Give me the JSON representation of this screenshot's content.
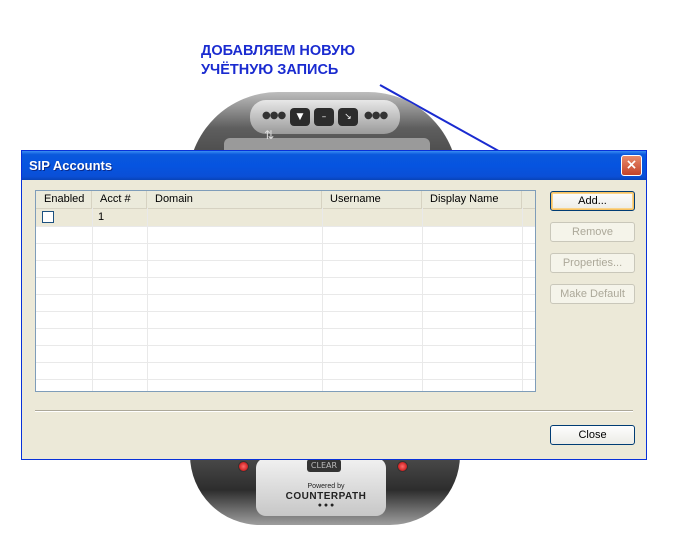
{
  "annotation": {
    "line1": "ДОБАВЛЯЕМ НОВУЮ",
    "line2": "УЧЁТНУЮ ЗАПИСЬ",
    "color": "#1a2bd0"
  },
  "phone": {
    "clear_label": "CLEAR",
    "powered_by": "Powered by",
    "brand": "COUNTERPATH"
  },
  "dialog": {
    "title": "SIP Accounts",
    "close_icon": "×",
    "columns": [
      "Enabled",
      "Acct #",
      "Domain",
      "Username",
      "Display Name"
    ],
    "rows": [
      {
        "enabled": false,
        "acct": "1",
        "domain": "",
        "username": "",
        "display_name": ""
      }
    ],
    "buttons": {
      "add": "Add...",
      "remove": "Remove",
      "properties": "Properties...",
      "make_default": "Make Default",
      "close": "Close"
    },
    "colors": {
      "title_bar": "#0654e0",
      "body": "#ece9d8"
    }
  }
}
